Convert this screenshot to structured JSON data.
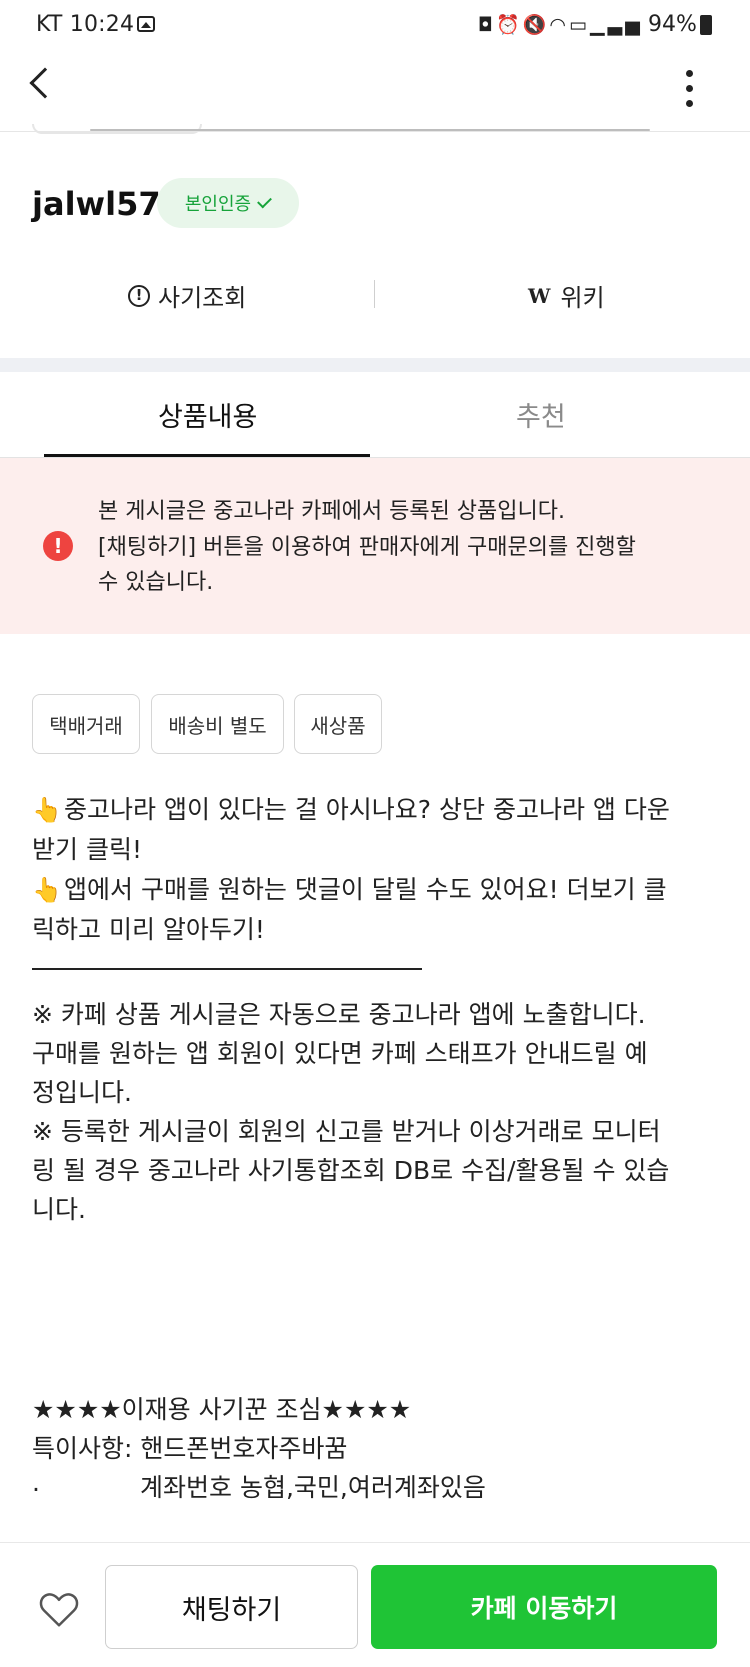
{
  "status_bar": {
    "carrier_time": "KT 10:24",
    "icons": [
      "gallery-icon",
      "vpn-icon",
      "alarm-icon",
      "mute-icon",
      "wifi-icon",
      "hd-icon",
      "signal-icon"
    ],
    "battery": "94%"
  },
  "nav": {
    "back_icon": "chevron-left-icon",
    "more_icon": "vertical-dots-icon"
  },
  "seller": {
    "username": "jalwl57",
    "verify_label": "본인인증"
  },
  "links": {
    "fraud_check": "사기조회",
    "wiki": "위키",
    "wiki_icon_glyph": "W",
    "fraud_icon_glyph": "!"
  },
  "tabs": [
    {
      "label": "상품내용",
      "active": true
    },
    {
      "label": "추천",
      "active": false
    }
  ],
  "notice": {
    "icon_glyph": "!",
    "line1": "본 게시글은 중고나라 카페에서 등록된 상품입니다.",
    "line2": "[채팅하기] 버튼을 이용하여 판매자에게 구매문의를 진행할",
    "line3": "수 있습니다."
  },
  "tags": [
    "택배거래",
    "배송비 별도",
    "새상품"
  ],
  "description": {
    "hand_glyph": "👆",
    "p1_l1": "중고나라 앱이 있다는 걸 아시나요? 상단 중고나라 앱 다운",
    "p1_l2": "받기 클릭!",
    "p2_l1": "앱에서 구매를 원하는 댓글이 달릴 수도 있어요! 더보기 클",
    "p2_l2": "릭하고 미리 알아두기!",
    "n1_l1": "※ 카페 상품 게시글은 자동으로 중고나라 앱에 노출합니다.",
    "n1_l2": "구매를 원하는 앱 회원이 있다면 카페 스태프가 안내드릴 예",
    "n1_l3": "정입니다.",
    "n2_l1": "※ 등록한 게시글이 회원의 신고를 받거나 이상거래로 모니터",
    "n2_l2": "링 될 경우 중고나라 사기통합조회 DB로 수집/활용될 수 있습",
    "n2_l3": "니다.",
    "warn_l1": "★★★★이재용 사기꾼 조심★★★★",
    "warn_l2": "특이사항: 핸드폰번호자주바꿈",
    "warn_l3_dot": ".",
    "warn_l3": "계좌번호 농협,국민,여러계좌있음"
  },
  "bottom_bar": {
    "like_icon": "heart-outline-icon",
    "chat_label": "채팅하기",
    "cafe_label": "카페 이동하기"
  },
  "colors": {
    "accent_green": "#1fc436",
    "badge_bg": "#e8f6ea",
    "notice_bg": "#fdeeed",
    "alert_red": "#ee4440"
  }
}
